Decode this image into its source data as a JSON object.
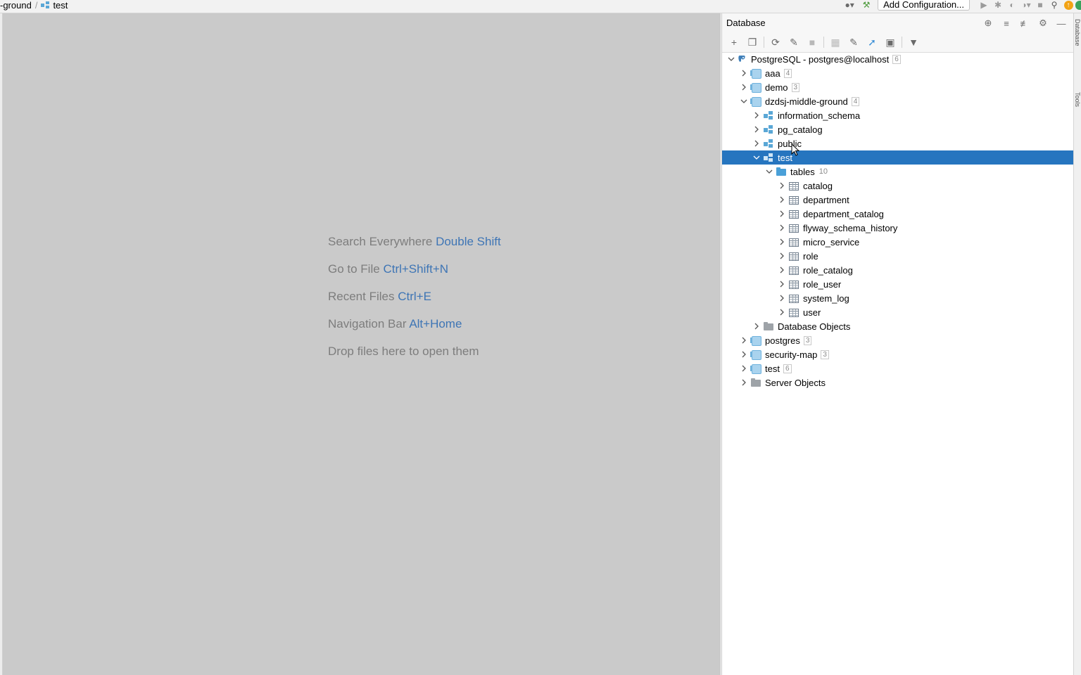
{
  "breadcrumb": {
    "project": "-ground",
    "schema": "test"
  },
  "toolbar": {
    "add_configuration": "Add Configuration..."
  },
  "editor": {
    "hints": [
      {
        "text": "Search Everywhere",
        "key": "Double Shift"
      },
      {
        "text": "Go to File",
        "key": "Ctrl+Shift+N"
      },
      {
        "text": "Recent Files",
        "key": "Ctrl+E"
      },
      {
        "text": "Navigation Bar",
        "key": "Alt+Home"
      },
      {
        "text": "Drop files here to open them",
        "key": ""
      }
    ]
  },
  "database_panel": {
    "title": "Database",
    "datasource": {
      "label": "PostgreSQL - postgres@localhost",
      "count": "6"
    },
    "databases": {
      "aaa": {
        "label": "aaa",
        "count": "4"
      },
      "demo": {
        "label": "demo",
        "count": "3"
      },
      "dzdsj": {
        "label": "dzdsj-middle-ground",
        "count": "4"
      },
      "postgres": {
        "label": "postgres",
        "count": "3"
      },
      "security_map": {
        "label": "security-map",
        "count": "3"
      },
      "test": {
        "label": "test",
        "count": "6"
      }
    },
    "schemas": {
      "information_schema": "information_schema",
      "pg_catalog": "pg_catalog",
      "public": "public",
      "test": "test"
    },
    "tables_folder": {
      "label": "tables",
      "count": "10"
    },
    "tables": [
      "catalog",
      "department",
      "department_catalog",
      "flyway_schema_history",
      "micro_service",
      "role",
      "role_catalog",
      "role_user",
      "system_log",
      "user"
    ],
    "database_objects": "Database Objects",
    "server_objects": "Server Objects"
  },
  "side_tabs": {
    "database": "Database",
    "tools": "Tools"
  },
  "colors": {
    "selection": "#2675bf",
    "hint_key": "#3e75b5",
    "editor_bg": "#cacaca"
  }
}
